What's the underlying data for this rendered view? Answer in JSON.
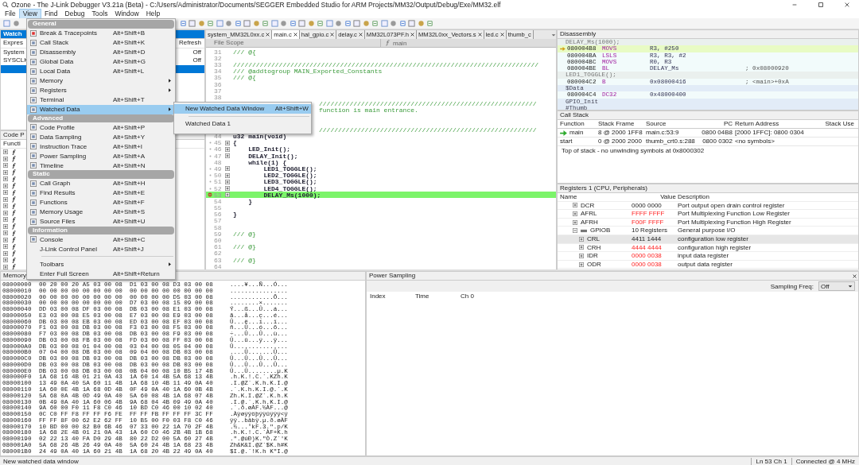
{
  "window": {
    "title": "Ozone - The J-Link Debugger V3.21a (Beta) - C:/Users/Administrator/Documents/SEGGER Embedded Studio for ARM Projects/MM32/Output/Debug/Exe/MM32.elf"
  },
  "menu_bar": [
    {
      "label": "File",
      "selected": false
    },
    {
      "label": "View",
      "selected": true
    },
    {
      "label": "Find",
      "selected": false
    },
    {
      "label": "Debug",
      "selected": false
    },
    {
      "label": "Tools",
      "selected": false
    },
    {
      "label": "Window",
      "selected": false
    },
    {
      "label": "Help",
      "selected": false
    }
  ],
  "watched_data": {
    "title": "Watch",
    "columns": [
      "Expres",
      "Refresh"
    ],
    "rows": [
      {
        "name": "System",
        "refresh": "Off",
        "selected": false
      },
      {
        "name": "SYSCLK",
        "refresh": "Off",
        "selected": false
      },
      {
        "selected": true
      }
    ]
  },
  "code_profile": {
    "title": "Code P",
    "column": "Functi",
    "rows": [
      {
        "expanded": false
      },
      {
        "expanded": false
      },
      {
        "expanded": false
      },
      {
        "expanded": false
      },
      {
        "expanded": false
      },
      {
        "expanded": false
      },
      {
        "expanded": false
      },
      {
        "expanded": false
      },
      {
        "expanded": false
      },
      {
        "expanded": false
      },
      {
        "expanded": false
      },
      {
        "expanded": false
      },
      {
        "expanded": false
      },
      {
        "expanded": false
      },
      {
        "expanded": false
      },
      {
        "expanded": false
      },
      {
        "expanded": false
      },
      {
        "expanded": false
      }
    ]
  },
  "view_menu": [
    {
      "kind": "header",
      "label": "General"
    },
    {
      "kind": "item",
      "label": "Break & Tracepoints",
      "shortcut": "Alt+Shift+B",
      "submenu": false,
      "selected": false
    },
    {
      "kind": "item",
      "label": "Call Stack",
      "shortcut": "Alt+Shift+K",
      "submenu": false,
      "selected": false
    },
    {
      "kind": "item",
      "label": "Disassembly",
      "shortcut": "Alt+Shift+D",
      "submenu": false,
      "selected": false
    },
    {
      "kind": "item",
      "label": "Global Data",
      "shortcut": "Alt+Shift+G",
      "submenu": false,
      "selected": false
    },
    {
      "kind": "item",
      "label": "Local Data",
      "shortcut": "Alt+Shift+L",
      "submenu": false,
      "selected": false
    },
    {
      "kind": "item",
      "label": "Memory",
      "submenu": true,
      "selected": false
    },
    {
      "kind": "item",
      "label": "Registers",
      "submenu": true,
      "selected": false
    },
    {
      "kind": "item",
      "label": "Terminal",
      "shortcut": "Alt+Shift+T",
      "submenu": false,
      "selected": false
    },
    {
      "kind": "item",
      "label": "Watched Data",
      "submenu": true,
      "selected": true
    },
    {
      "kind": "header",
      "label": "Advanced"
    },
    {
      "kind": "item",
      "label": "Code Profile",
      "shortcut": "Alt+Shift+P",
      "submenu": false,
      "selected": false
    },
    {
      "kind": "item",
      "label": "Data Sampling",
      "shortcut": "Alt+Shift+Y",
      "submenu": false,
      "selected": false
    },
    {
      "kind": "item",
      "label": "Instruction Trace",
      "shortcut": "Alt+Shift+I",
      "submenu": false,
      "selected": false
    },
    {
      "kind": "item",
      "label": "Power Sampling",
      "shortcut": "Alt+Shift+A",
      "submenu": false,
      "selected": false
    },
    {
      "kind": "item",
      "label": "Timeline",
      "shortcut": "Alt+Shift+N",
      "submenu": false,
      "selected": false
    },
    {
      "kind": "header",
      "label": "Static"
    },
    {
      "kind": "item",
      "label": "Call Graph",
      "shortcut": "Alt+Shift+H",
      "submenu": false,
      "selected": false
    },
    {
      "kind": "item",
      "label": "Find Results",
      "shortcut": "Alt+Shift+E",
      "submenu": false,
      "selected": false
    },
    {
      "kind": "item",
      "label": "Functions",
      "shortcut": "Alt+Shift+F",
      "submenu": false,
      "selected": false
    },
    {
      "kind": "item",
      "label": "Memory Usage",
      "shortcut": "Alt+Shift+S",
      "submenu": false,
      "selected": false
    },
    {
      "kind": "item",
      "label": "Source Files",
      "shortcut": "Alt+Shift+U",
      "submenu": false,
      "selected": false
    },
    {
      "kind": "header",
      "label": "Information"
    },
    {
      "kind": "item",
      "label": "Console",
      "shortcut": "Alt+Shift+C",
      "submenu": false,
      "selected": false
    },
    {
      "kind": "item",
      "label": "J-Link Control Panel",
      "shortcut": "Alt+Shift+J",
      "submenu": false,
      "selected": false
    },
    {
      "kind": "separator"
    },
    {
      "kind": "item",
      "label": "Toolbars",
      "submenu": true,
      "selected": false
    },
    {
      "kind": "item",
      "label": "Enter Full Screen",
      "shortcut": "Alt+Shift+Return",
      "submenu": false,
      "selected": false
    }
  ],
  "watched_data_submenu": [
    {
      "label": "New Watched Data Window",
      "shortcut": "Alt+Shift+W",
      "selected": true
    },
    {
      "label": "Watched Data 1",
      "selected": false
    }
  ],
  "editor": {
    "tabs": [
      {
        "label": "system_MM32L0xx.c",
        "selected": false
      },
      {
        "label": "main.c",
        "selected": true
      },
      {
        "label": "hal_gpio.c",
        "selected": false
      },
      {
        "label": "delay.c",
        "selected": false
      },
      {
        "label": "MM32L073PF.h",
        "selected": false
      },
      {
        "label": "MM32L0xx_Vectors.s",
        "selected": false
      },
      {
        "label": "led.c",
        "selected": false
      },
      {
        "label": "thumb_c",
        "selected": false
      }
    ],
    "scope": "File Scope",
    "function": "main",
    "lines": [
      {
        "num": "31",
        "text": "/// @{",
        "kind": "comment",
        "marker": false,
        "fold": false,
        "current": false
      },
      {
        "num": "32",
        "kind": "code",
        "marker": false,
        "fold": false,
        "current": false
      },
      {
        "num": "33",
        "text": "////////////////////////////////////////////////////////////////////////////////",
        "kind": "comment",
        "marker": false,
        "fold": false,
        "current": false
      },
      {
        "num": "34",
        "text": "/// @addtogroup MAIN_Exported_Constants",
        "kind": "comment",
        "marker": false,
        "fold": false,
        "current": false
      },
      {
        "num": "35",
        "text": "/// @{",
        "kind": "comment",
        "marker": false,
        "fold": false,
        "current": false
      },
      {
        "num": "36",
        "kind": "code",
        "marker": false,
        "fold": false,
        "current": false
      },
      {
        "num": "37",
        "kind": "code",
        "marker": false,
        "fold": false,
        "current": false
      },
      {
        "num": "38",
        "kind": "code",
        "marker": false,
        "fold": false,
        "current": false
      },
      {
        "text": "/////////////////////////////////////////////////////////",
        "kind": "covered"
      },
      {
        "text": "function is main entrance.",
        "kind": "covered"
      },
      {
        "kind": "covered"
      },
      {
        "kind": "covered"
      },
      {
        "text": "/////////////////////////////////////////////////////////",
        "kind": "covered"
      },
      {
        "num": "44",
        "text": "u32 main(void)",
        "kind": "code",
        "marker": false,
        "fold": false,
        "current": false
      },
      {
        "num": "45",
        "text": "{",
        "kind": "code",
        "marker": true,
        "fold": true,
        "current": false
      },
      {
        "num": "46",
        "text": "    LED_Init();",
        "kind": "code",
        "marker": true,
        "fold": true,
        "current": false
      },
      {
        "num": "47",
        "text": "    DELAY_Init();",
        "kind": "code",
        "marker": true,
        "fold": true,
        "current": false
      },
      {
        "num": "48",
        "text": "    while(1) {",
        "kind": "code",
        "marker": false,
        "fold": false,
        "current": false
      },
      {
        "num": "49",
        "text": "        LED1_TOGGLE();",
        "kind": "code",
        "marker": true,
        "fold": true,
        "current": false
      },
      {
        "num": "50",
        "text": "        LED2_TOGGLE();",
        "kind": "code",
        "marker": true,
        "fold": true,
        "current": false
      },
      {
        "num": "51",
        "text": "        LED3_TOGGLE();",
        "kind": "code",
        "marker": true,
        "fold": true,
        "current": false
      },
      {
        "num": "52",
        "text": "        LED4_TOGGLE();",
        "kind": "code",
        "marker": true,
        "fold": true,
        "current": false
      },
      {
        "num": "53",
        "text": "        DELAY_Ms(1000);",
        "kind": "code",
        "fold": true,
        "current": true
      },
      {
        "num": "54",
        "text": "    }",
        "kind": "code",
        "marker": false,
        "fold": false,
        "current": false
      },
      {
        "num": "55",
        "kind": "code",
        "marker": false,
        "fold": false,
        "current": false
      },
      {
        "num": "56",
        "text": "}",
        "kind": "code",
        "marker": false,
        "fold": false,
        "current": false
      },
      {
        "num": "57",
        "kind": "code",
        "marker": false,
        "fold": false,
        "current": false
      },
      {
        "num": "58",
        "kind": "code",
        "marker": false,
        "fold": false,
        "current": false
      },
      {
        "num": "59",
        "text": "/// @}",
        "kind": "comment",
        "marker": false,
        "fold": false,
        "current": false
      },
      {
        "num": "60",
        "kind": "code",
        "marker": false,
        "fold": false,
        "current": false
      },
      {
        "num": "61",
        "text": "/// @}",
        "kind": "comment",
        "marker": false,
        "fold": false,
        "current": false
      },
      {
        "num": "62",
        "kind": "code",
        "marker": false,
        "fold": false,
        "current": false
      },
      {
        "num": "63",
        "text": "/// @}",
        "kind": "comment",
        "marker": false,
        "fold": false,
        "current": false
      },
      {
        "num": "64",
        "kind": "code",
        "marker": false,
        "fold": false,
        "current": false
      }
    ]
  },
  "disassembly": {
    "title": "Disassembly",
    "lines": [
      {
        "kind": "source",
        "text": "DELAY_Ms(1000);"
      },
      {
        "kind": "instr",
        "addr": "080004B8",
        "op": "MOVS",
        "args": "R3, #250",
        "current": true
      },
      {
        "kind": "instr",
        "addr": "080004BA",
        "op": "LSLS",
        "args": "R3, R3, #2",
        "current": false
      },
      {
        "kind": "instr",
        "addr": "080004BC",
        "op": "MOVS",
        "args": "R0, R3",
        "current": false
      },
      {
        "kind": "instr",
        "addr": "080004BE",
        "op": "BL",
        "args": "DELAY_Ms",
        "comment": "; 0x08000920",
        "current": false
      },
      {
        "kind": "source",
        "text": "LED1_TOGGLE();"
      },
      {
        "kind": "instr",
        "addr": "080004C2",
        "op": "B",
        "args": "0x08000416",
        "comment": "; <main>+0xA",
        "current": false
      },
      {
        "kind": "label",
        "text": "$Data"
      },
      {
        "kind": "instr",
        "addr": "080004C4",
        "op": "DC32",
        "args": "0x48000400",
        "current": false
      },
      {
        "kind": "label",
        "text": "GPIO_Init"
      },
      {
        "kind": "label",
        "text": "#Thumb"
      }
    ]
  },
  "call_stack": {
    "title": "Call Stack",
    "columns": [
      "Function",
      "Stack Frame",
      "Source",
      "PC",
      "Return Address",
      "Stack Use"
    ],
    "rows": [
      {
        "function": "main",
        "frame": "8 @ 2000 1FF8",
        "source": "main.c:53:9",
        "pc": "0800 04B8",
        "return": "[2000 1FFC]: 0800 0304",
        "current": true
      },
      {
        "function": "start",
        "frame": "0 @ 2000 2000",
        "source": "thumb_crt0.s:288",
        "pc": "0800 0302",
        "return": "<no symbols>",
        "current": false
      }
    ],
    "note": "Top of stack - no unwinding symbols at 0x8000302"
  },
  "registers": {
    "title": "Registers 1 (CPU, Peripherals)",
    "columns": [
      "Name",
      "Value",
      "Description"
    ],
    "rows": [
      {
        "name": "DCR",
        "value": "0000 0000",
        "description": "Port output open drain control register",
        "changed": false,
        "selected": false,
        "expanded": false
      },
      {
        "name": "AFRL",
        "value": "FFFF FFFF",
        "description": "Port Multiplexing Function Low Register",
        "changed": true,
        "selected": false,
        "expanded": false
      },
      {
        "name": "AFRH",
        "value": "F00F FFFF",
        "description": "Port Multiplexing Function High Register",
        "changed": true,
        "selected": false,
        "expanded": false
      },
      {
        "name": "GPIOB",
        "value": "10 Registers",
        "description": "General purpose I/O",
        "changed": false,
        "selected": false,
        "expanded": true,
        "children": [
          {
            "name": "CRL",
            "value": "4411 1444",
            "description": "configuration low register",
            "changed": false,
            "selected": true,
            "expanded": false
          },
          {
            "name": "CRH",
            "value": "4444 4444",
            "description": "configuration high register",
            "changed": true,
            "selected": false,
            "expanded": false
          },
          {
            "name": "IDR",
            "value": "0000 0038",
            "description": "input data register",
            "changed": true,
            "selected": false,
            "expanded": false
          },
          {
            "name": "ODR",
            "value": "0000 0038",
            "description": "output data register",
            "changed": true,
            "selected": false,
            "expanded": false
          }
        ]
      }
    ]
  },
  "memory": {
    "title": "Memory",
    "rows": [
      {
        "addr": "08000000",
        "hex": "00 20 00 20 A5 03 00 08  D1 03 00 08 D3 03 00 08",
        "ascii": "....¥...Ñ...Ó..."
      },
      {
        "addr": "08000010",
        "hex": "00 00 00 00 00 00 00 00  00 00 00 00 00 00 00 00",
        "ascii": "................"
      },
      {
        "addr": "08000020",
        "hex": "00 00 00 00 00 00 00 00  00 00 00 00 D5 03 00 08",
        "ascii": "............Õ..."
      },
      {
        "addr": "08000030",
        "hex": "00 00 00 00 00 00 00 00  D7 03 00 08 15 09 00 08",
        "ascii": "........×......."
      },
      {
        "addr": "08000040",
        "hex": "DD 03 00 08 DF 03 00 08  DB 03 00 08 E1 03 00 08",
        "ascii": "Ý...ß...Û...á..."
      },
      {
        "addr": "08000050",
        "hex": "E3 03 00 08 E5 03 00 08  E7 03 00 08 E9 03 00 08",
        "ascii": "ã...å...ç...é..."
      },
      {
        "addr": "08000060",
        "hex": "DB 03 00 08 EB 03 00 08  ED 03 00 08 EF 03 00 08",
        "ascii": "Û...ë...í...ï..."
      },
      {
        "addr": "08000070",
        "hex": "F1 03 00 08 DB 03 00 08  F3 03 00 08 F5 03 00 08",
        "ascii": "ñ...Û...ó...õ..."
      },
      {
        "addr": "08000080",
        "hex": "F7 03 00 08 DB 03 00 08  DB 03 00 08 F9 03 00 08",
        "ascii": "÷...Û...Û...ù..."
      },
      {
        "addr": "08000090",
        "hex": "DB 03 00 08 FB 03 00 08  FD 03 00 08 FF 03 00 08",
        "ascii": "Û...û...ý...ÿ..."
      },
      {
        "addr": "080000A0",
        "hex": "DB 03 00 08 01 04 00 08  03 04 00 08 05 04 00 08",
        "ascii": "Û..............."
      },
      {
        "addr": "080000B0",
        "hex": "07 04 00 08 DB 03 00 08  09 04 00 08 DB 03 00 08",
        "ascii": "....Û.......Û..."
      },
      {
        "addr": "080000C0",
        "hex": "DB 03 00 08 DB 03 00 08  DB 03 00 08 DB 03 00 08",
        "ascii": "Û...Û...Û...Û..."
      },
      {
        "addr": "080000D0",
        "hex": "DB 03 00 08 DB 03 00 08  DB 03 00 08 DB 03 00 08",
        "ascii": "Û...Û...Û...Û..."
      },
      {
        "addr": "080000E0",
        "hex": "DB 03 00 08 DB 03 00 08  0B 04 00 08 10 B5 17 4B",
        "ascii": "Û...Û........µ.K"
      },
      {
        "addr": "080000F0",
        "hex": "1A 68 16 4B 01 21 0A 43  1A 60 14 4B 5A 68 13 4B",
        "ascii": ".h.K.!.C.`.KZh.K"
      },
      {
        "addr": "08000100",
        "hex": "13 49 0A 40 5A 60 11 4B  1A 68 10 4B 11 49 0A 40",
        "ascii": ".I.@Z`.K.h.K.I.@"
      },
      {
        "addr": "08000110",
        "hex": "1A 60 0E 4B 1A 68 0D 4B  0F 49 0A 40 1A 60 0B 4B",
        "ascii": ".`.K.h.K.I.@.`.K"
      },
      {
        "addr": "08000120",
        "hex": "5A 68 0A 4B 0D 49 0A 40  5A 60 08 4B 1A 68 07 4B",
        "ascii": "Zh.K.I.@Z`.K.h.K"
      },
      {
        "addr": "08000130",
        "hex": "0B 49 0A 40 1A 60 06 4B  9A 68 04 4B 09 49 0A 40",
        "ascii": ".I.@.`.K.h.K.I.@"
      },
      {
        "addr": "08000140",
        "hex": "9A 60 00 F0 11 F8 C0 46  10 BD C0 46 00 10 02 40",
        "ascii": ".`.ð.øÀF.½ÀF...@"
      },
      {
        "addr": "08000150",
        "hex": "0C C0 FF F8 FF FF F6 FE  FF FF FB FF FF FF 3C FF",
        "ascii": ".Àÿøÿÿöþÿÿûÿÿÿ<ÿ"
      },
      {
        "addr": "08000160",
        "hex": "FF FF 8F 00 62 E2 62 FF  10 B5 00 F0 03 F8 C0 46",
        "ascii": "ÿÿ..bâbÿ.µ.ð.øÀF"
      },
      {
        "addr": "08000170",
        "hex": "10 BD 00 00 82 B0 6B 46  07 33 00 22 1A 70 2F 4B",
        "ascii": ".½...°kF.3.\".p/K"
      },
      {
        "addr": "08000180",
        "hex": "1A 68 2E 4B 01 21 0A 43  1A 60 C0 46 2B 4B 1B 68",
        "ascii": ".h.K.!.C.`ÀF+K.h"
      },
      {
        "addr": "08000190",
        "hex": "02 22 13 40 FA D0 29 4B  80 22 D2 00 5A 60 27 4B",
        "ascii": ".\".@úÐ)K.\"Ò.Z`'K"
      },
      {
        "addr": "080001A0",
        "hex": "5A 68 26 4B 26 49 0A 40  5A 60 24 4B 1A 68 23 4B",
        "ascii": "Zh&K&I.@Z`$K.h#K"
      },
      {
        "addr": "080001B0",
        "hex": "24 49 0A 40 1A 60 21 4B  1A 68 20 4B 22 49 0A 40",
        "ascii": "$I.@.`!K.h K\"I.@"
      }
    ]
  },
  "power_sampling": {
    "title": "Power Sampling",
    "freq_label": "Sampling Freq:",
    "freq_value": "Off",
    "columns": [
      "Index",
      "Time",
      "Ch 0"
    ]
  },
  "status_bar": {
    "message": "New watched data window",
    "position": "Ln 53  Ch 1",
    "connection": "Connected @ 4 MHz"
  }
}
